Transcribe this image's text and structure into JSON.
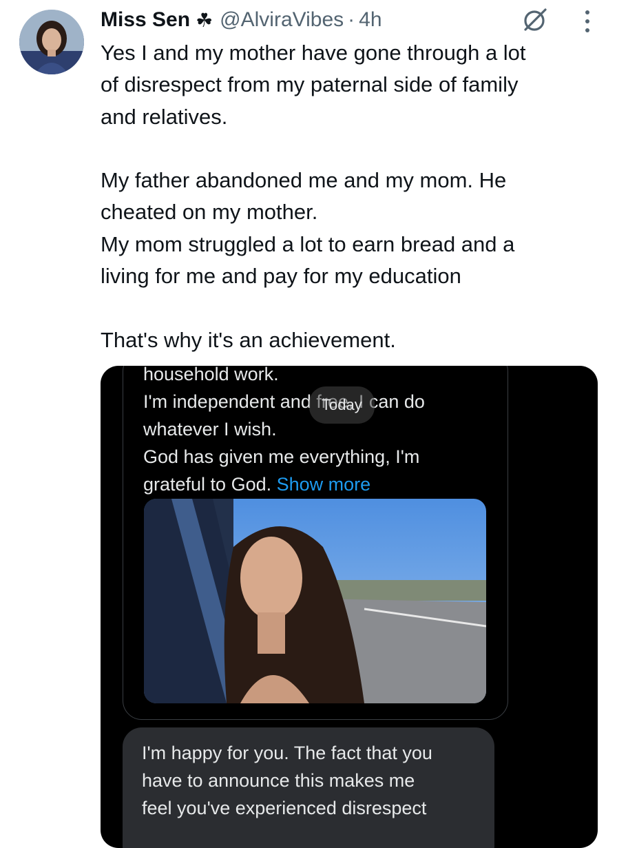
{
  "tweet": {
    "author_name": "Miss Sen",
    "badge": "☘",
    "handle": "@AlviraVibes",
    "separator": "·",
    "time": "4h",
    "text": "Yes I and my mother have gone through a lot\nof disrespect from my paternal side of family\nand relatives.\n\nMy father abandoned me and my mom. He\ncheated on my mother.\nMy mom struggled a lot to earn bread and a\nliving for me and pay for my education\n\nThat's why it's an achievement."
  },
  "icons": {
    "grok": "grok-icon",
    "more": "more-vertical-icon",
    "avatar": "avatar"
  },
  "screenshot": {
    "cut_line": "household work.",
    "line1": "I'm independent and free, I can do",
    "line2": "whatever I wish.",
    "line3": "God has given me everything, I'm",
    "line4_prefix": "grateful to God. ",
    "show_more": "Show more",
    "date_pill": "Today",
    "reply_line1": "I'm happy for you. The fact that you",
    "reply_line2": "have to announce this makes me",
    "reply_line3": "feel you've experienced disrespect"
  },
  "colors": {
    "text": "#0f1419",
    "secondary": "#536471",
    "link": "#1d9bf0",
    "dark_bg": "#000000",
    "bubble": "#2b2d31"
  }
}
